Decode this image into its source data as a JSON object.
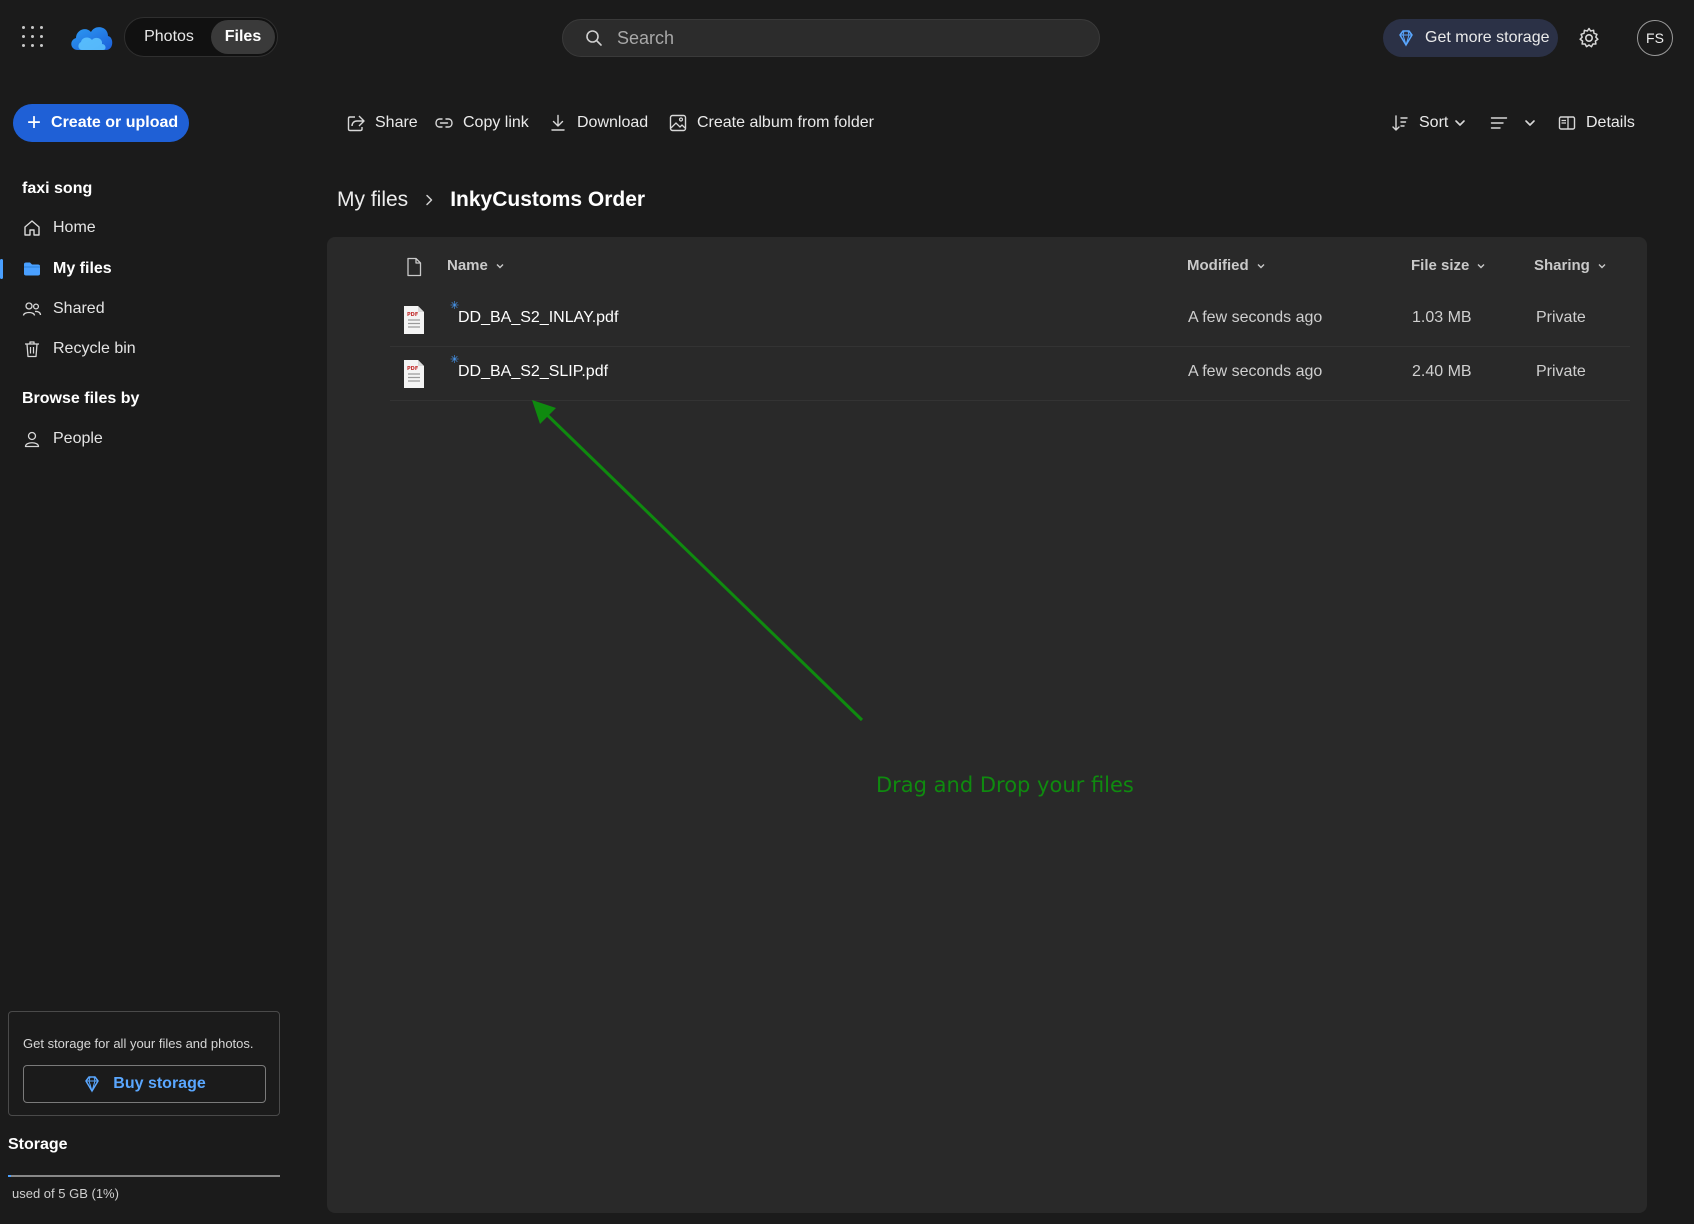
{
  "topbar": {
    "mode_photos": "Photos",
    "mode_files": "Files",
    "active_mode": "Files",
    "search_placeholder": "Search",
    "get_storage_label": "Get more storage",
    "avatar_initials": "FS"
  },
  "sidebar": {
    "create_label": "Create or upload",
    "user_name": "faxi song",
    "items": [
      {
        "label": "Home",
        "icon": "home-icon",
        "active": false
      },
      {
        "label": "My files",
        "icon": "folder-icon",
        "active": true
      },
      {
        "label": "Shared",
        "icon": "people-icon",
        "active": false
      },
      {
        "label": "Recycle bin",
        "icon": "trash-icon",
        "active": false
      }
    ],
    "browse_title": "Browse files by",
    "browse_items": [
      {
        "label": "People",
        "icon": "person-icon"
      }
    ],
    "promo_text": "Get storage for all your files and photos.",
    "buy_label": "Buy storage",
    "storage_title": "Storage",
    "storage_used_text": "used of 5 GB (1%)",
    "storage_used_percent": 1
  },
  "commands": {
    "share": "Share",
    "copy_link": "Copy link",
    "download": "Download",
    "create_album": "Create album from folder",
    "sort": "Sort",
    "details": "Details"
  },
  "breadcrumb": {
    "root": "My files",
    "current": "InkyCustoms Order"
  },
  "list": {
    "columns": {
      "name": "Name",
      "modified": "Modified",
      "file_size": "File size",
      "sharing": "Sharing"
    },
    "rows": [
      {
        "name": "DD_BA_S2_INLAY.pdf",
        "modified": "A few seconds ago",
        "size": "1.03 MB",
        "sharing": "Private"
      },
      {
        "name": "DD_BA_S2_SLIP.pdf",
        "modified": "A few seconds ago",
        "size": "2.40 MB",
        "sharing": "Private"
      }
    ]
  },
  "annotation": {
    "text": "Drag and Drop your files",
    "color": "#0f8a0f"
  },
  "colors": {
    "accent": "#1f60d6",
    "link_blue": "#5aa7ff",
    "background": "#1b1b1b",
    "panel": "#292929"
  }
}
